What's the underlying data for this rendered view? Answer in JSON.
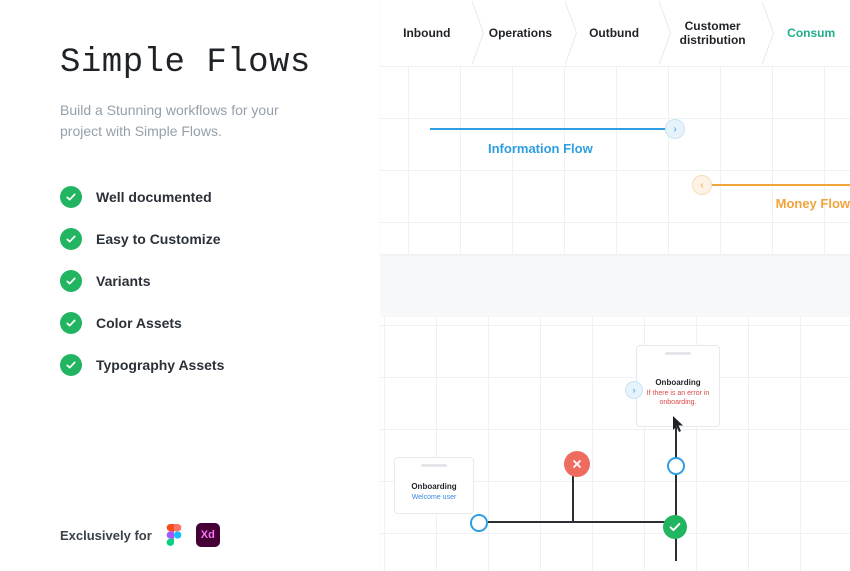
{
  "sidebar": {
    "title": "Simple Flows",
    "subtitle": "Build a Stunning workflows for your project with Simple Flows.",
    "features": [
      "Well documented",
      "Easy to Customize",
      "Variants",
      "Color Assets",
      "Typography Assets"
    ],
    "exclusive_label": "Exclusively for",
    "apps": {
      "figma": "Figma",
      "xd": "Xd"
    }
  },
  "top_panel": {
    "steps": [
      {
        "label": "Inbound",
        "active": false
      },
      {
        "label": "Operations",
        "active": false
      },
      {
        "label": "Outbund",
        "active": false
      },
      {
        "label": "Customer distribution",
        "active": false
      },
      {
        "label": "Consum",
        "active": true
      }
    ],
    "flows": {
      "information": {
        "label": "Information Flow",
        "color": "#2f9ee3"
      },
      "money": {
        "label": "Money Flow",
        "color": "#f1a33c"
      }
    }
  },
  "bottom_panel": {
    "cards": {
      "welcome": {
        "title": "Onboarding",
        "subtitle": "Welcome user"
      },
      "error": {
        "title": "Onboarding",
        "subtitle": "If there is an error in onboarding."
      }
    }
  },
  "colors": {
    "accent_green": "#22b561",
    "accent_blue": "#2f9ee3",
    "accent_orange": "#f1a33c",
    "accent_red": "#ed6b5f",
    "teal": "#1fae8a"
  }
}
